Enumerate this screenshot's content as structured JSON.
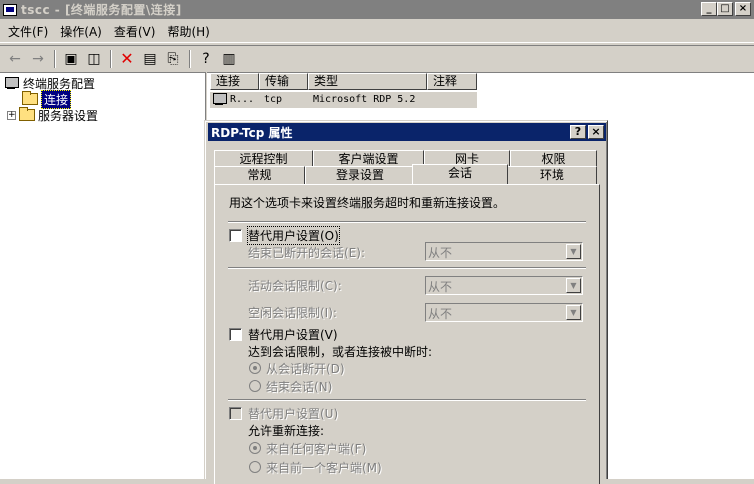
{
  "window": {
    "title": "tscc - [终端服务配置\\连接]",
    "btn_min": "_",
    "btn_max": "□",
    "btn_close": "×"
  },
  "menu": {
    "items": [
      {
        "label": "文件(F)"
      },
      {
        "label": "操作(A)"
      },
      {
        "label": "查看(V)"
      },
      {
        "label": "帮助(H)"
      }
    ]
  },
  "toolbar": {
    "back": "←",
    "forward": "→",
    "up": "▣",
    "show_tree": "◫",
    "delete": "✕",
    "properties": "▤",
    "export": "⎘",
    "help": "?",
    "console": "▥"
  },
  "tree": {
    "root": "终端服务配置",
    "connections": "连接",
    "server_settings": "服务器设置",
    "expand": "+"
  },
  "list": {
    "headers": [
      "连接",
      "传输",
      "类型",
      "注释"
    ],
    "rows": [
      {
        "name": "R...",
        "transport": "tcp",
        "type": "Microsoft RDP 5.2",
        "comment": ""
      }
    ]
  },
  "dialog": {
    "title": "RDP-Tcp 属性",
    "help_btn": "?",
    "close_btn": "×",
    "tabs_row1": [
      "远程控制",
      "客户端设置",
      "网卡",
      "权限"
    ],
    "tabs_row2": [
      "常规",
      "登录设置",
      "会话",
      "环境"
    ],
    "description": "用这个选项卡来设置终端服务超时和重新连接设置。",
    "group1": {
      "checkbox_label": "替代用户设置(O)",
      "end_disconnected": "结束已断开的会话(E):",
      "end_disconnected_value": "从不",
      "active_limit": "活动会话限制(C):",
      "active_limit_value": "从不",
      "idle_limit": "空闲会话限制(I):",
      "idle_limit_value": "从不"
    },
    "group2": {
      "checkbox_label": "替代用户设置(V)",
      "when_reached": "达到会话限制，或者连接被中断时:",
      "radio_disconnect": "从会话断开(D)",
      "radio_end": "结束会话(N)"
    },
    "group3": {
      "checkbox_label": "替代用户设置(U)",
      "allow_reconnect": "允许重新连接:",
      "radio_any_client": "来自任何客户端(F)",
      "radio_prev_client": "来自前一个客户端(M)"
    },
    "dropdown_arrow": "▼"
  }
}
